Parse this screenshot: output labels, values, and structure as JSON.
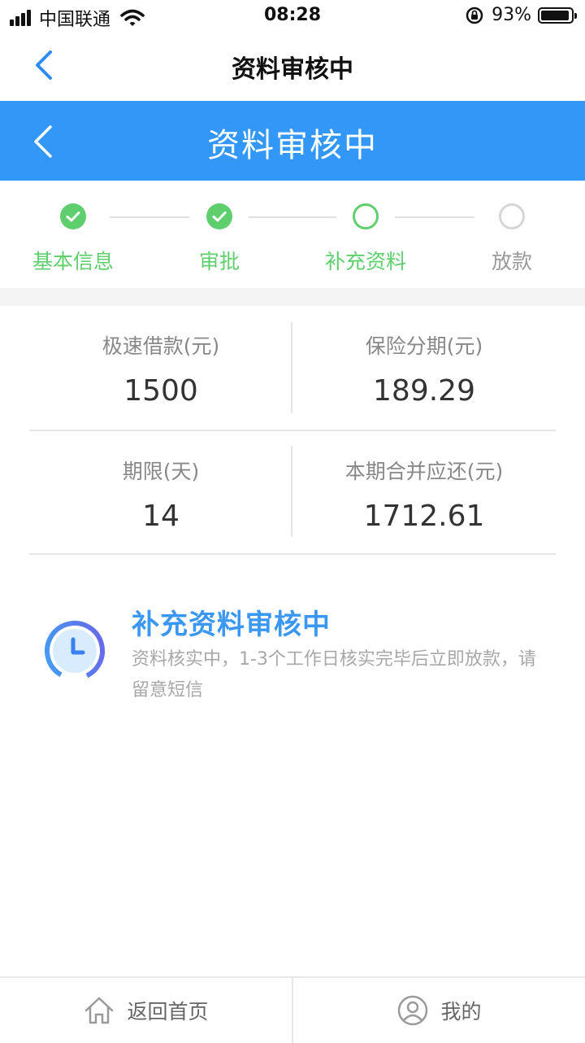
{
  "status_bar": {
    "carrier": "中国联通",
    "time": "08:28",
    "battery_percent": "93%"
  },
  "nav": {
    "title": "资料审核中"
  },
  "header": {
    "title": "资料审核中",
    "color": "#3397f7"
  },
  "steps": [
    {
      "label": "基本信息",
      "state": "done"
    },
    {
      "label": "审批",
      "state": "done"
    },
    {
      "label": "补充资料",
      "state": "current"
    },
    {
      "label": "放款",
      "state": "pending"
    }
  ],
  "summary": {
    "loan_label": "极速借款(元)",
    "loan_value": "1500",
    "insurance_label": "保险分期(元)",
    "insurance_value": "189.29",
    "term_label": "期限(天)",
    "term_value": "14",
    "due_label": "本期合并应还(元)",
    "due_value": "1712.61"
  },
  "notice": {
    "title": "补充资料审核中",
    "description": "资料核实中，1-3个工作日核实完毕后立即放款，请留意短信",
    "icon": "clock-icon"
  },
  "tabbar": {
    "home_label": "返回首页",
    "mine_label": "我的"
  },
  "colors": {
    "accent_green": "#5fcf6e",
    "accent_blue": "#3a97f2"
  }
}
